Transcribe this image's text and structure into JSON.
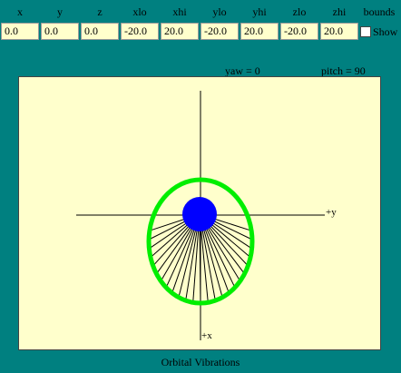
{
  "controls": {
    "labels": [
      "x",
      "y",
      "z",
      "xlo",
      "xhi",
      "ylo",
      "yhi",
      "zlo",
      "zhi",
      "bounds"
    ],
    "values": [
      "0.0",
      "0.0",
      "0.0",
      "-20.0",
      "20.0",
      "-20.0",
      "20.0",
      "-20.0",
      "20.0"
    ],
    "show_label": "Show",
    "show_checked": false
  },
  "status": {
    "yaw": "yaw = 0",
    "pitch": "pitch = 90"
  },
  "axes": {
    "y_label": "+y",
    "x_label": "+x"
  },
  "colors": {
    "background": "#008080",
    "panel": "#ffffcc",
    "orbit": "#00ee00",
    "body": "#0000ff",
    "lines": "#000000"
  },
  "caption": "Orbital Vibrations"
}
